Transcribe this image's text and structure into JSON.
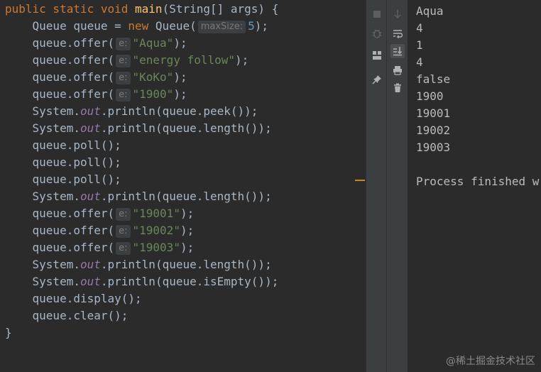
{
  "editor": {
    "code": {
      "l1": {
        "kw": "public static void ",
        "method": "main",
        "rest": "(String[] args) {"
      },
      "l2": {
        "a": "Queue queue = ",
        "kw": "new ",
        "b": "Queue(",
        "hint": "maxSize:",
        "num": "5",
        "c": ");"
      },
      "l3": {
        "a": "queue.offer(",
        "hint": "e:",
        "str": "\"Aqua\"",
        "c": ");"
      },
      "l4": {
        "a": "queue.offer(",
        "hint": "e:",
        "str": "\"energy follow\"",
        "c": ");"
      },
      "l5": {
        "a": "queue.offer(",
        "hint": "e:",
        "str": "\"KoKo\"",
        "c": ");"
      },
      "l6": {
        "a": "queue.offer(",
        "hint": "e:",
        "str": "\"1900\"",
        "c": ");"
      },
      "l7": {
        "a": "System.",
        "field": "out",
        "b": ".println(queue.peek());"
      },
      "l8": {
        "a": "System.",
        "field": "out",
        "b": ".println(queue.length());"
      },
      "l9": "queue.poll();",
      "l10": "queue.poll();",
      "l11": "queue.poll();",
      "l12": {
        "a": "System.",
        "field": "out",
        "b": ".println(queue.length());"
      },
      "l13": {
        "a": "queue.offer(",
        "hint": "e:",
        "str": "\"19001\"",
        "c": ");"
      },
      "l14": {
        "a": "queue.offer(",
        "hint": "e:",
        "str": "\"19002\"",
        "c": ");"
      },
      "l15": {
        "a": "queue.offer(",
        "hint": "e:",
        "str": "\"19003\"",
        "c": ");"
      },
      "l16": {
        "a": "System.",
        "field": "out",
        "b": ".println(queue.length());"
      },
      "l17": {
        "a": "System.",
        "field": "out",
        "b": ".println(queue.isEmpty());"
      },
      "l18": "queue.display();",
      "l19": "queue.clear();",
      "l20": "}"
    }
  },
  "toolbar": {
    "left_icons": [
      "stop-icon",
      "debug-bug-icon",
      "layout-icon",
      "pin-icon"
    ],
    "right_icons": [
      "scroll-down-icon",
      "soft-wrap-icon",
      "scroll-to-end-icon",
      "print-icon",
      "trash-icon"
    ]
  },
  "console": {
    "lines": [
      "Aqua",
      "4",
      "1",
      "4",
      "false",
      "1900",
      "19001",
      "19002",
      "19003",
      "",
      "Process finished w"
    ]
  },
  "watermark": "@稀土掘金技术社区",
  "colors": {
    "background": "#2b2b2b",
    "keyword": "#cc7832",
    "method": "#ffc66d",
    "string": "#6a8759",
    "number": "#6897bb",
    "field": "#9876aa",
    "text": "#a9b7c6",
    "toolbar": "#3c3f41"
  }
}
